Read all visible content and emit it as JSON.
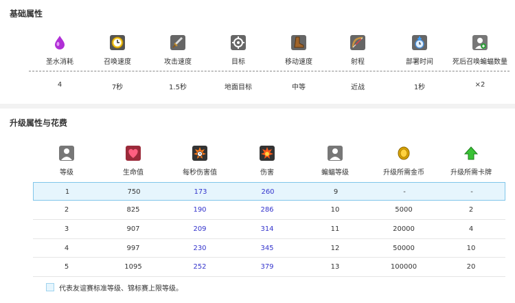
{
  "basic": {
    "title": "基础属性",
    "attributes": [
      {
        "label": "圣水消耗",
        "value": "4",
        "icon": "elixir-drop-icon"
      },
      {
        "label": "召唤速度",
        "value": "7秒",
        "icon": "clock-icon"
      },
      {
        "label": "攻击速度",
        "value": "1.5秒",
        "icon": "sword-icon"
      },
      {
        "label": "目标",
        "value": "地面目标",
        "icon": "crosshair-icon"
      },
      {
        "label": "移动速度",
        "value": "中等",
        "icon": "boot-icon"
      },
      {
        "label": "射程",
        "value": "近战",
        "icon": "bow-icon"
      },
      {
        "label": "部署时间",
        "value": "1秒",
        "icon": "deploy-clock-icon"
      },
      {
        "label": "死后召唤蝙蝠数量",
        "value": "×2",
        "icon": "bat-spawn-icon"
      }
    ]
  },
  "upgrade": {
    "title": "升级属性与花费",
    "columns": [
      {
        "label": "等级",
        "icon": "level-person-icon"
      },
      {
        "label": "生命值",
        "icon": "heart-icon"
      },
      {
        "label": "每秒伤害值",
        "icon": "dps-explosion-icon"
      },
      {
        "label": "伤害",
        "icon": "damage-explosion-icon"
      },
      {
        "label": "蝙蝠等级",
        "icon": "bat-level-person-icon"
      },
      {
        "label": "升级所需金币",
        "icon": "gold-coin-icon"
      },
      {
        "label": "升级所需卡牌",
        "icon": "green-arrow-up-icon"
      }
    ],
    "rows": [
      [
        "1",
        "750",
        "173",
        "260",
        "9",
        "-",
        "-"
      ],
      [
        "2",
        "825",
        "190",
        "286",
        "10",
        "5000",
        "2"
      ],
      [
        "3",
        "907",
        "209",
        "314",
        "11",
        "20000",
        "4"
      ],
      [
        "4",
        "997",
        "230",
        "345",
        "12",
        "50000",
        "10"
      ],
      [
        "5",
        "1095",
        "252",
        "379",
        "13",
        "100000",
        "20"
      ]
    ],
    "highlight_row": 0,
    "legend": "代表友谊赛标准等级、锦标赛上限等级。"
  },
  "colors": {
    "highlight_bg": "#e6f5fd",
    "highlight_border": "#7fc5ea",
    "blue_value": "#3333cc"
  }
}
